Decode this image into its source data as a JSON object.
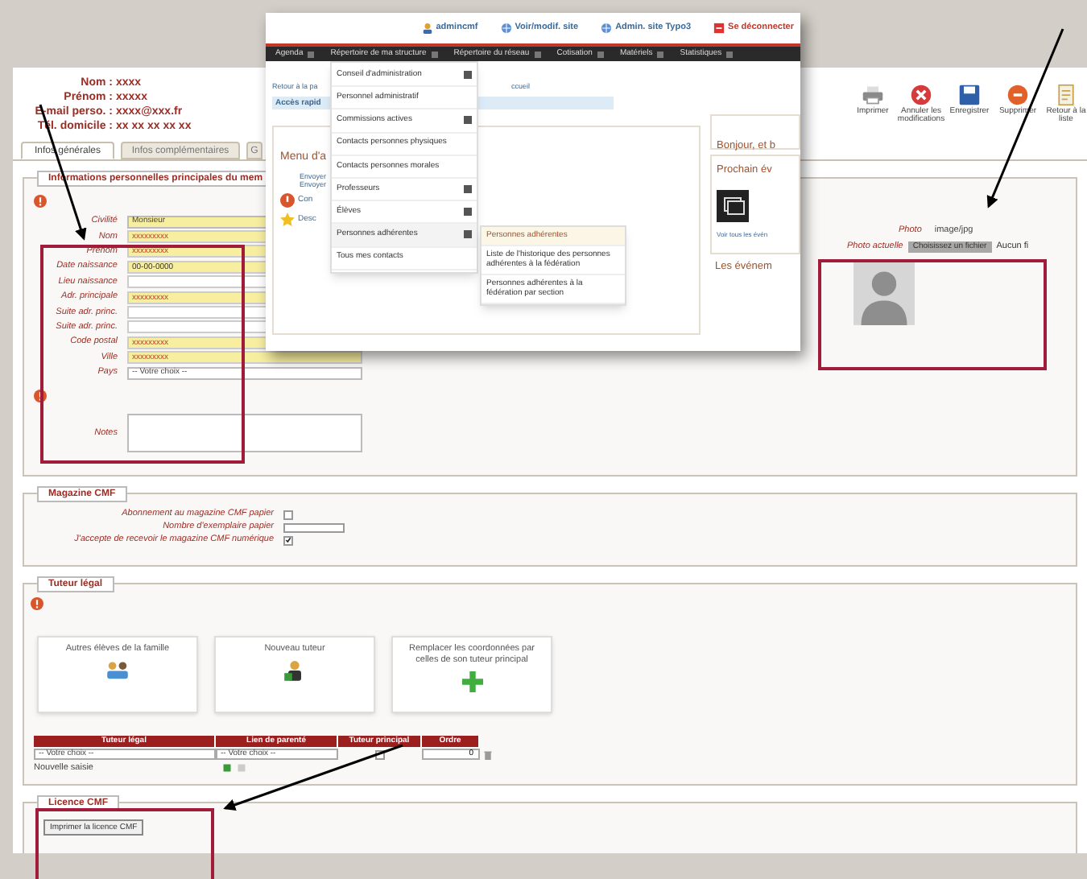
{
  "header": {
    "identity": [
      {
        "label": "Nom :",
        "value": "xxxx"
      },
      {
        "label": "Prénom :",
        "value": "xxxxx"
      },
      {
        "label": "E-mail perso. :",
        "value": "xxxx@xxx.fr"
      },
      {
        "label": "Tél. domicile :",
        "value": "xx xx xx xx xx"
      }
    ],
    "toolbar": [
      {
        "kind": "print",
        "label": "Imprimer"
      },
      {
        "kind": "cancel",
        "label": "Annuler les modifications"
      },
      {
        "kind": "save",
        "label": "Enregistrer"
      },
      {
        "kind": "delete",
        "label": "Supprimer"
      },
      {
        "kind": "back",
        "label": "Retour à la liste"
      }
    ]
  },
  "tabs": [
    {
      "label": "Infos générales",
      "selected": true
    },
    {
      "label": "Infos complémentaires",
      "selected": false
    },
    {
      "label": "G",
      "selected": false
    }
  ],
  "personal": {
    "legend": "Informations personnelles principales du mem",
    "fields": [
      {
        "kind": "select",
        "label": "Civilité",
        "value": "Monsieur",
        "required": true
      },
      {
        "kind": "text",
        "label": "Nom",
        "value": "xxxxxxxxx",
        "required": true
      },
      {
        "kind": "text",
        "label": "Prénom",
        "value": "xxxxxxxxx",
        "required": true
      },
      {
        "kind": "text",
        "label": "Date naissance",
        "value": "00-00-0000",
        "required": true
      },
      {
        "kind": "text",
        "label": "Lieu naissance",
        "required": false
      },
      {
        "kind": "text",
        "label": "Adr. principale",
        "value": "xxxxxxxxx",
        "required": true
      },
      {
        "kind": "text",
        "label": "Suite adr. princ.",
        "required": false
      },
      {
        "kind": "text",
        "label": "Suite adr. princ.",
        "required": false
      },
      {
        "kind": "text",
        "label": "Code postal",
        "value": "xxxxxxxxx",
        "required": true
      },
      {
        "kind": "text",
        "label": "Ville",
        "value": "xxxxxxxxx",
        "required": true
      },
      {
        "kind": "select",
        "label": "Pays",
        "value": "-- Votre choix --",
        "required": false
      },
      {
        "kind": "textarea",
        "label": "Notes",
        "required": false
      }
    ],
    "photo": {
      "label": "Photo",
      "format": "image/jpg",
      "current_label": "Photo actuelle",
      "button": "Choisissez un fichier",
      "file_status": "Aucun fi"
    }
  },
  "magazine": {
    "legend": "Magazine CMF",
    "rows": [
      {
        "kind": "checkbox",
        "label": "Abonnement au magazine CMF papier",
        "checked": false
      },
      {
        "kind": "input",
        "label": "Nombre d'exemplaire papier"
      },
      {
        "kind": "checkbox",
        "label": "J'accepte de recevoir le magazine CMF numérique",
        "checked": true
      }
    ]
  },
  "guardian": {
    "legend": "Tuteur légal",
    "cards": [
      {
        "kind": "family",
        "label": "Autres élèves de la famille"
      },
      {
        "kind": "new",
        "label": "Nouveau tuteur"
      },
      {
        "kind": "replace",
        "label": "Remplacer les coordonnées par celles de son tuteur principal"
      }
    ],
    "columns": [
      "Tuteur légal",
      "Lien de parenté",
      "Tuteur principal",
      "Ordre"
    ],
    "row": {
      "guardian": "-- Votre choix --",
      "relation": "-- Votre choix --",
      "principal": false,
      "order": "0"
    },
    "new_entry": "Nouvelle saisie"
  },
  "licence": {
    "legend": "Licence CMF",
    "button": "Imprimer la licence CMF"
  },
  "popup": {
    "top_links": [
      {
        "kind": "user",
        "label": "admincmf"
      },
      {
        "kind": "globe",
        "label": "Voir/modif. site"
      },
      {
        "kind": "globe",
        "label": "Admin. site Typo3"
      },
      {
        "kind": "logout",
        "label": "Se déconnecter"
      }
    ],
    "nav": [
      "Agenda",
      "Répertoire de ma structure",
      "Répertoire du réseau",
      "Cotisation",
      "Matériels",
      "Statistiques"
    ],
    "menu": [
      {
        "label": "Conseil d'administration",
        "submenu": true,
        "selected": false
      },
      {
        "label": "Personnel administratif",
        "submenu": false,
        "selected": false
      },
      {
        "label": "Commissions actives",
        "submenu": true,
        "selected": false
      },
      {
        "label": "Contacts personnes physiques",
        "submenu": false,
        "selected": false
      },
      {
        "label": "Contacts personnes morales",
        "submenu": false,
        "selected": false
      },
      {
        "label": "Professeurs",
        "submenu": true,
        "selected": false
      },
      {
        "label": "Élèves",
        "submenu": true,
        "selected": false
      },
      {
        "label": "Personnes adhérentes",
        "submenu": true,
        "selected": true
      },
      {
        "label": "Tous mes contacts",
        "submenu": false,
        "selected": false
      }
    ],
    "submenu": [
      {
        "label": "Personnes adhérentes",
        "selected": true
      },
      {
        "label": "Liste de l'historique des personnes adhérentes à la fédération",
        "selected": false
      },
      {
        "label": "Personnes adhérentes à la fédération par section",
        "selected": false
      }
    ],
    "back_link": "Retour à la pa",
    "back_link_end": "ccueil",
    "quick_access": "Accès rapid",
    "panel_title": "Menu d'a",
    "panel_links": [
      "Envoyer",
      "Envoyer"
    ],
    "panel_items": [
      {
        "kind": "help",
        "label": "Con"
      },
      {
        "kind": "star",
        "label": "Desc"
      }
    ],
    "right": {
      "greeting": "Bonjour, et b",
      "events_title": "Prochain év",
      "events_link": "Voir tous les évén",
      "events_title_2": "Les événem"
    }
  }
}
